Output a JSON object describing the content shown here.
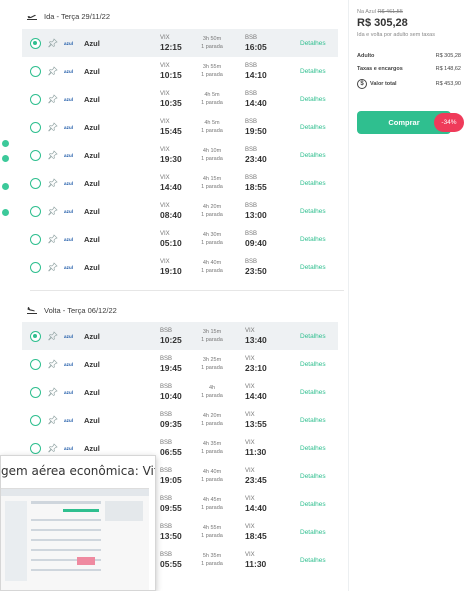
{
  "outbound": {
    "header": "Ida - Terça 29/11/22",
    "flights": [
      {
        "airline": "Azul",
        "dep_code": "VIX",
        "dep_time": "12:15",
        "duration": "3h 50m",
        "stops": "1 parada",
        "arr_code": "BSB",
        "arr_time": "16:05",
        "details": "Detalhes",
        "selected": true
      },
      {
        "airline": "Azul",
        "dep_code": "VIX",
        "dep_time": "10:15",
        "duration": "3h 55m",
        "stops": "1 parada",
        "arr_code": "BSB",
        "arr_time": "14:10",
        "details": "Detalhes",
        "selected": false
      },
      {
        "airline": "Azul",
        "dep_code": "VIX",
        "dep_time": "10:35",
        "duration": "4h 5m",
        "stops": "1 parada",
        "arr_code": "BSB",
        "arr_time": "14:40",
        "details": "Detalhes",
        "selected": false
      },
      {
        "airline": "Azul",
        "dep_code": "VIX",
        "dep_time": "15:45",
        "duration": "4h 5m",
        "stops": "1 parada",
        "arr_code": "BSB",
        "arr_time": "19:50",
        "details": "Detalhes",
        "selected": false
      },
      {
        "airline": "Azul",
        "dep_code": "VIX",
        "dep_time": "19:30",
        "duration": "4h 10m",
        "stops": "1 parada",
        "arr_code": "BSB",
        "arr_time": "23:40",
        "details": "Detalhes",
        "selected": false
      },
      {
        "airline": "Azul",
        "dep_code": "VIX",
        "dep_time": "14:40",
        "duration": "4h 15m",
        "stops": "1 parada",
        "arr_code": "BSB",
        "arr_time": "18:55",
        "details": "Detalhes",
        "selected": false
      },
      {
        "airline": "Azul",
        "dep_code": "VIX",
        "dep_time": "08:40",
        "duration": "4h 20m",
        "stops": "1 parada",
        "arr_code": "BSB",
        "arr_time": "13:00",
        "details": "Detalhes",
        "selected": false
      },
      {
        "airline": "Azul",
        "dep_code": "VIX",
        "dep_time": "05:10",
        "duration": "4h 30m",
        "stops": "1 parada",
        "arr_code": "BSB",
        "arr_time": "09:40",
        "details": "Detalhes",
        "selected": false
      },
      {
        "airline": "Azul",
        "dep_code": "VIX",
        "dep_time": "19:10",
        "duration": "4h 40m",
        "stops": "1 parada",
        "arr_code": "BSB",
        "arr_time": "23:50",
        "details": "Detalhes",
        "selected": false
      }
    ]
  },
  "return": {
    "header": "Volta - Terça 06/12/22",
    "flights": [
      {
        "airline": "Azul",
        "dep_code": "BSB",
        "dep_time": "10:25",
        "duration": "3h 15m",
        "stops": "1 parada",
        "arr_code": "VIX",
        "arr_time": "13:40",
        "details": "Detalhes",
        "selected": true
      },
      {
        "airline": "Azul",
        "dep_code": "BSB",
        "dep_time": "19:45",
        "duration": "3h 25m",
        "stops": "1 parada",
        "arr_code": "VIX",
        "arr_time": "23:10",
        "details": "Detalhes",
        "selected": false
      },
      {
        "airline": "Azul",
        "dep_code": "BSB",
        "dep_time": "10:40",
        "duration": "4h",
        "stops": "1 parada",
        "arr_code": "VIX",
        "arr_time": "14:40",
        "details": "Detalhes",
        "selected": false
      },
      {
        "airline": "Azul",
        "dep_code": "BSB",
        "dep_time": "09:35",
        "duration": "4h 20m",
        "stops": "1 parada",
        "arr_code": "VIX",
        "arr_time": "13:55",
        "details": "Detalhes",
        "selected": false
      },
      {
        "airline": "Azul",
        "dep_code": "BSB",
        "dep_time": "06:55",
        "duration": "4h 35m",
        "stops": "1 parada",
        "arr_code": "VIX",
        "arr_time": "11:30",
        "details": "Detalhes",
        "selected": false
      },
      {
        "airline": "Azul",
        "dep_code": "BSB",
        "dep_time": "19:05",
        "duration": "4h 40m",
        "stops": "1 parada",
        "arr_code": "VIX",
        "arr_time": "23:45",
        "details": "Detalhes",
        "selected": false
      },
      {
        "airline": "Azul",
        "dep_code": "BSB",
        "dep_time": "09:55",
        "duration": "4h 45m",
        "stops": "1 parada",
        "arr_code": "VIX",
        "arr_time": "14:40",
        "details": "Detalhes",
        "selected": false
      },
      {
        "airline": "Azul",
        "dep_code": "BSB",
        "dep_time": "13:50",
        "duration": "4h 55m",
        "stops": "1 parada",
        "arr_code": "VIX",
        "arr_time": "18:45",
        "details": "Detalhes",
        "selected": false
      },
      {
        "airline": "Azul",
        "dep_code": "BSB",
        "dep_time": "05:55",
        "duration": "5h 35m",
        "stops": "1 parada",
        "arr_code": "VIX",
        "arr_time": "11:30",
        "details": "Detalhes",
        "selected": false
      }
    ]
  },
  "summary": {
    "orig_prefix": "Na Azul",
    "orig_price": "R$ 461,55",
    "price": "R$ 305,28",
    "note": "Ida e volta por adulto sem taxas",
    "adult_label": "Adulto",
    "adult_value": "R$ 305,28",
    "fees_label": "Taxas e encargos",
    "fees_value": "R$ 148,62",
    "total_label": "Valor total",
    "total_value": "R$ 453,90",
    "buy_label": "Comprar",
    "discount": "-34%"
  },
  "popup": {
    "title": "gem aérea econômica: Vit..."
  },
  "colors": {
    "accent": "#2fbf8f",
    "badge": "#ef3b5a",
    "airline_logo": "#1b58a7"
  }
}
